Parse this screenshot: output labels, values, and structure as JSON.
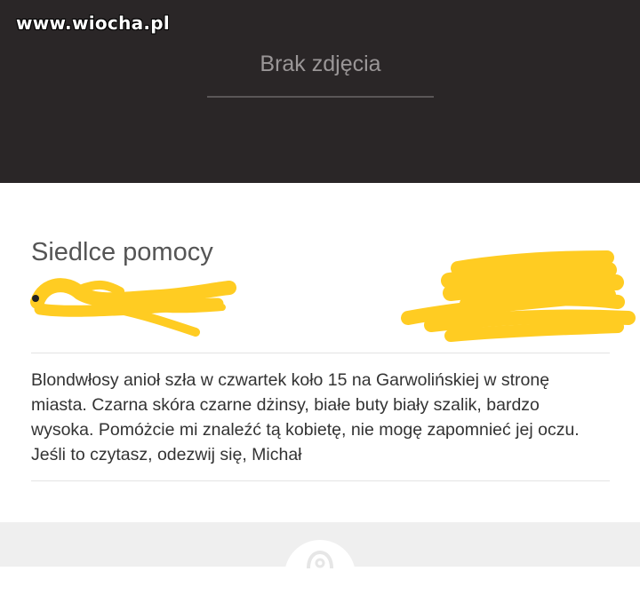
{
  "header": {
    "watermark": "www.wiocha.pl",
    "no_photo_text": "Brak zdjęcia"
  },
  "post": {
    "title": "Siedlce pomocy",
    "body": "Blondwłosy anioł szła w czwartek koło 15 na Garwolińskiej w stronę miasta. Czarna skóra czarne dżinsy, białe buty biały szalik, bardzo wysoka. Pomóżcie mi znaleźć tą kobietę, nie mogę zapomnieć jej oczu. Jeśli to czytasz, odezwij się, Michał"
  },
  "colors": {
    "header_bg": "#2a2627",
    "redaction": "#ffcc22",
    "footer_bg": "#efefef"
  },
  "icons": {
    "fab": "location-pin-icon"
  }
}
